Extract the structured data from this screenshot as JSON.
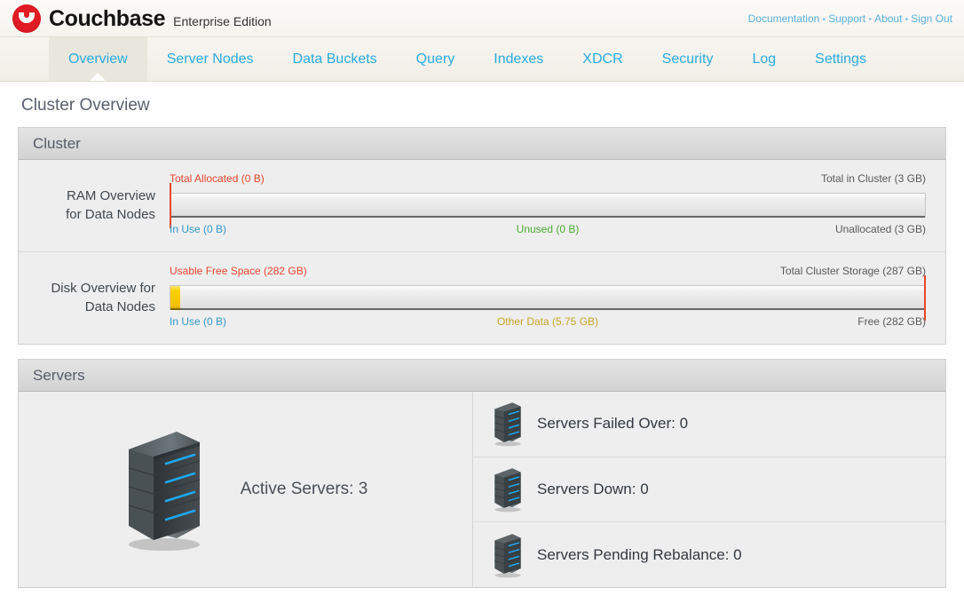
{
  "header": {
    "brand_name": "Couchbase",
    "edition": "Enterprise Edition",
    "logo_color": "#e01b24",
    "links": [
      {
        "label": "Documentation",
        "name": "documentation-link"
      },
      {
        "label": "Support",
        "name": "support-link"
      },
      {
        "label": "About",
        "name": "about-link"
      },
      {
        "label": "Sign Out",
        "name": "sign-out-link"
      }
    ],
    "link_separator": "•",
    "link_color": "#5bb0dc"
  },
  "tabs": [
    {
      "label": "Overview",
      "active": true
    },
    {
      "label": "Server Nodes",
      "active": false
    },
    {
      "label": "Data Buckets",
      "active": false
    },
    {
      "label": "Query",
      "active": false
    },
    {
      "label": "Indexes",
      "active": false
    },
    {
      "label": "XDCR",
      "active": false
    },
    {
      "label": "Security",
      "active": false
    },
    {
      "label": "Log",
      "active": false
    },
    {
      "label": "Settings",
      "active": false
    }
  ],
  "page": {
    "title": "Cluster Overview"
  },
  "cluster": {
    "section_title": "Cluster",
    "ram": {
      "label_line1": "RAM Overview",
      "label_line2": "for Data Nodes",
      "top_left": "Total Allocated (0 B)",
      "top_right": "Total in Cluster (3 GB)",
      "bottom_left": "In Use (0 B)",
      "bottom_mid": "Unused (0 B)",
      "bottom_right": "Unallocated (3 GB)",
      "fill_percent": 0
    },
    "disk": {
      "label_line1": "Disk Overview for",
      "label_line2": "Data Nodes",
      "top_left": "Usable Free Space (282 GB)",
      "top_right": "Total Cluster Storage (287 GB)",
      "bottom_left": "In Use (0 B)",
      "bottom_mid": "Other Data (5.75 GB)",
      "bottom_right": "Free (282 GB)",
      "fill_percent": 2
    }
  },
  "servers": {
    "section_title": "Servers",
    "active_label": "Active Servers: 3",
    "rows": [
      {
        "label": "Servers Failed Over: 0"
      },
      {
        "label": "Servers Down: 0"
      },
      {
        "label": "Servers Pending Rebalance: 0"
      }
    ]
  },
  "chart_data": {
    "type": "bar",
    "title": "Cluster Resource Overview",
    "charts": [
      {
        "name": "RAM Overview for Data Nodes",
        "total_label": "Total in Cluster",
        "total_value_gb": 3,
        "segments": [
          {
            "name": "In Use",
            "value_bytes": 0,
            "display": "0 B",
            "color": "#3399cc"
          },
          {
            "name": "Unused",
            "value_bytes": 0,
            "display": "0 B",
            "color": "#4caa2f"
          },
          {
            "name": "Unallocated",
            "value_gb": 3,
            "display": "3 GB",
            "color": "#5a5a5a"
          }
        ],
        "markers": [
          {
            "name": "Total Allocated",
            "display": "0 B",
            "position_percent": 0,
            "color": "#e8472f"
          }
        ],
        "filled_percent": 0
      },
      {
        "name": "Disk Overview for Data Nodes",
        "total_label": "Total Cluster Storage",
        "total_value_gb": 287,
        "segments": [
          {
            "name": "In Use",
            "value_bytes": 0,
            "display": "0 B",
            "color": "#3399cc"
          },
          {
            "name": "Other Data",
            "value_gb": 5.75,
            "display": "5.75 GB",
            "color": "#c9a42a"
          },
          {
            "name": "Free",
            "value_gb": 282,
            "display": "282 GB",
            "color": "#5a5a5a"
          }
        ],
        "markers": [
          {
            "name": "Usable Free Space",
            "display": "282 GB",
            "position_percent": 100,
            "color": "#e8472f"
          }
        ],
        "filled_percent": 2
      }
    ],
    "server_counts": {
      "categories": [
        "Active Servers",
        "Servers Failed Over",
        "Servers Down",
        "Servers Pending Rebalance"
      ],
      "values": [
        3,
        0,
        0,
        0
      ]
    }
  }
}
